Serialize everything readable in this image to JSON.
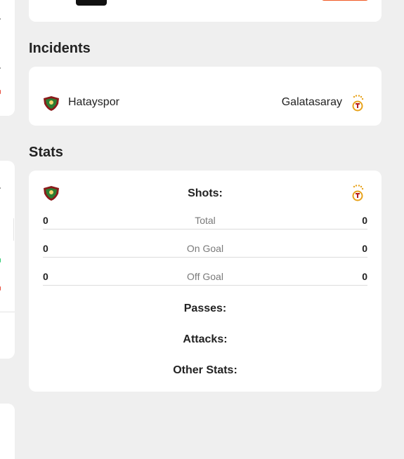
{
  "sections": {
    "incidents_title": "Incidents",
    "stats_title": "Stats"
  },
  "teams": {
    "home": {
      "name": "Hatayspor",
      "crest_icon": "hatayspor-crest-icon",
      "color": "#8b1a1a"
    },
    "away": {
      "name": "Galatasaray",
      "crest_icon": "galatasaray-crest-icon",
      "color": "#e8a31d"
    }
  },
  "stats": {
    "shots": {
      "title": "Shots:",
      "rows": [
        {
          "label": "Total",
          "home": "0",
          "away": "0"
        },
        {
          "label": "On Goal",
          "home": "0",
          "away": "0"
        },
        {
          "label": "Off Goal",
          "home": "0",
          "away": "0"
        }
      ]
    },
    "passes_title": "Passes:",
    "attacks_title": "Attacks:",
    "other_title": "Other Stats:"
  },
  "colors": {
    "accent": "#f15a24",
    "background": "#efefef"
  }
}
